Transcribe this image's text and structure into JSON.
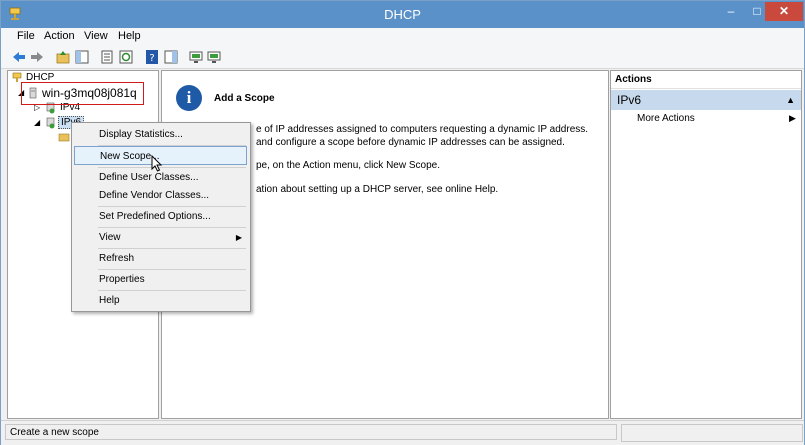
{
  "window": {
    "title": "DHCP",
    "min": "–",
    "max": "□",
    "close": "✕"
  },
  "menu": [
    "File",
    "Action",
    "View",
    "Help"
  ],
  "tree": {
    "root": "DHCP",
    "server": "win-g3mq08j081q",
    "ipv4": "IPv4",
    "ipv6": "IPv6"
  },
  "center": {
    "title": "Add a Scope",
    "line1": "e of IP addresses assigned to computers requesting a dynamic IP address.",
    "line2": "and configure a scope before dynamic IP addresses can be assigned.",
    "line3": "pe, on the Action menu, click New Scope.",
    "line4": "ation about setting up a DHCP server, see online Help.",
    "info_glyph": "i"
  },
  "actions": {
    "header": "Actions",
    "selected": "IPv6",
    "more": "More Actions"
  },
  "context_menu": {
    "items": [
      "Display Statistics...",
      "New Scope...",
      "Define User Classes...",
      "Define Vendor Classes...",
      "Set Predefined Options...",
      "View",
      "Refresh",
      "Properties",
      "Help"
    ],
    "highlighted": "New Scope..."
  },
  "status": {
    "text": "Create a new scope"
  },
  "colors": {
    "titlebar": "#5a91c9",
    "highlight": "#e5f1fb",
    "annotation_box": "#d11a1a"
  }
}
